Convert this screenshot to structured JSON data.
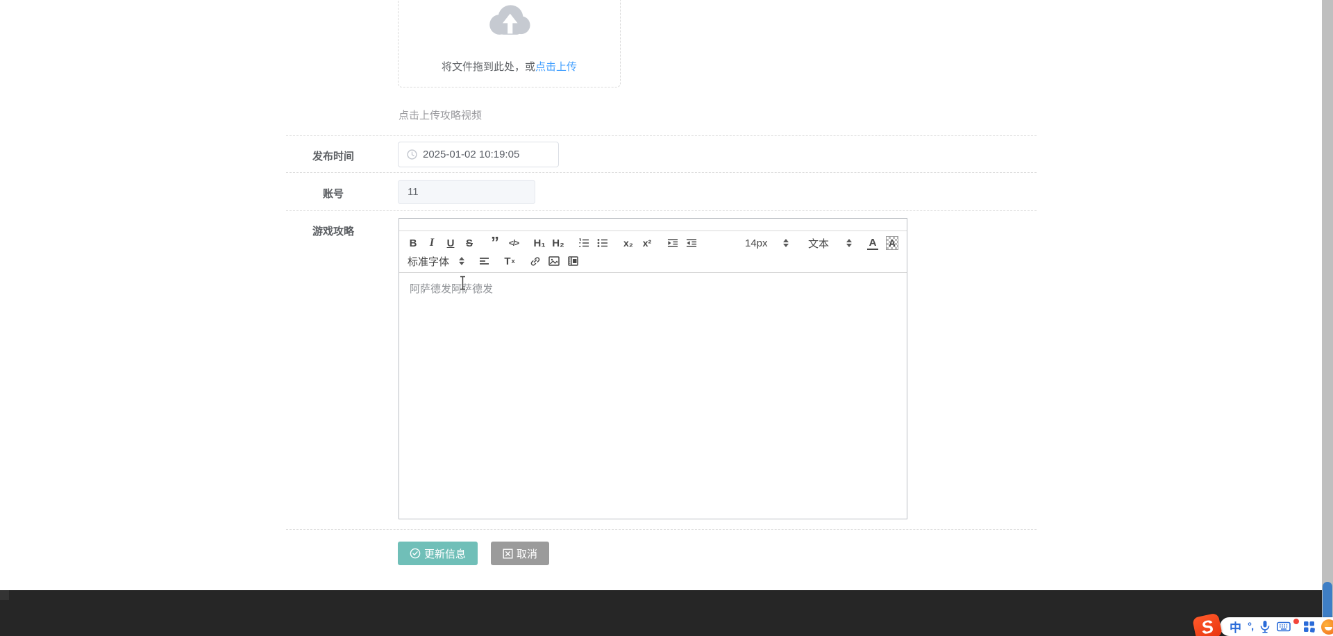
{
  "upload": {
    "drag_text": "将文件拖到此处，或",
    "click_link": "点击上传",
    "hint": "点击上传攻略视频"
  },
  "form": {
    "publish_time": {
      "label": "发布时间",
      "value": "2025-01-02 10:19:05"
    },
    "account": {
      "label": "账号",
      "value": "11"
    },
    "strategy": {
      "label": "游戏攻略"
    }
  },
  "editor": {
    "toolbar": {
      "bold": "B",
      "italic": "I",
      "underline": "U",
      "strike": "S",
      "blockquote": "”",
      "code": "</>",
      "header1": "H₁",
      "header2": "H₂",
      "subscript": "x₂",
      "superscript": "x²",
      "font_size": "14px",
      "format": "文本",
      "text_color": "A",
      "bg_color": "A",
      "font_family": "标准字体",
      "clear_format_t": "T",
      "clear_format_x": "x"
    },
    "content": "阿萨德发阿萨德发"
  },
  "buttons": {
    "update": "更新信息",
    "cancel": "取消"
  },
  "taskbar": {
    "ime_logo": "S",
    "ime_mode": "中",
    "ime_punct": "°,"
  },
  "colors": {
    "link_blue": "#409eff",
    "update_button": "#70bfb8",
    "cancel_button": "#9b9b9b",
    "footer": "#262626",
    "scroll_thumb": "#3e7ec5",
    "ime_blue": "#2a6bd8"
  }
}
